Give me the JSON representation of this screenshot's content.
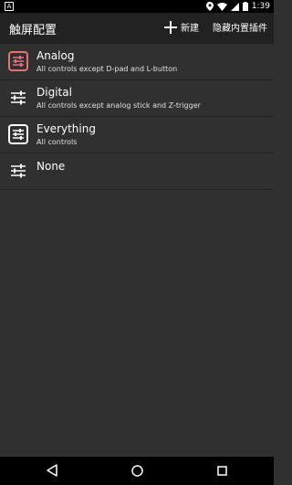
{
  "status": {
    "notification_letter": "A",
    "time": "1:39"
  },
  "appbar": {
    "title": "触屏配置",
    "new_label": "新建",
    "hide_label": "隐藏内置插件"
  },
  "profiles": [
    {
      "name": "Analog",
      "description": "All controls except D-pad and L-button"
    },
    {
      "name": "Digital",
      "description": "All controls except analog stick and Z-trigger"
    },
    {
      "name": "Everything",
      "description": "All controls"
    },
    {
      "name": "None",
      "description": ""
    }
  ],
  "colors": {
    "analog_icon": "#e57373",
    "icon": "#ffffff"
  }
}
